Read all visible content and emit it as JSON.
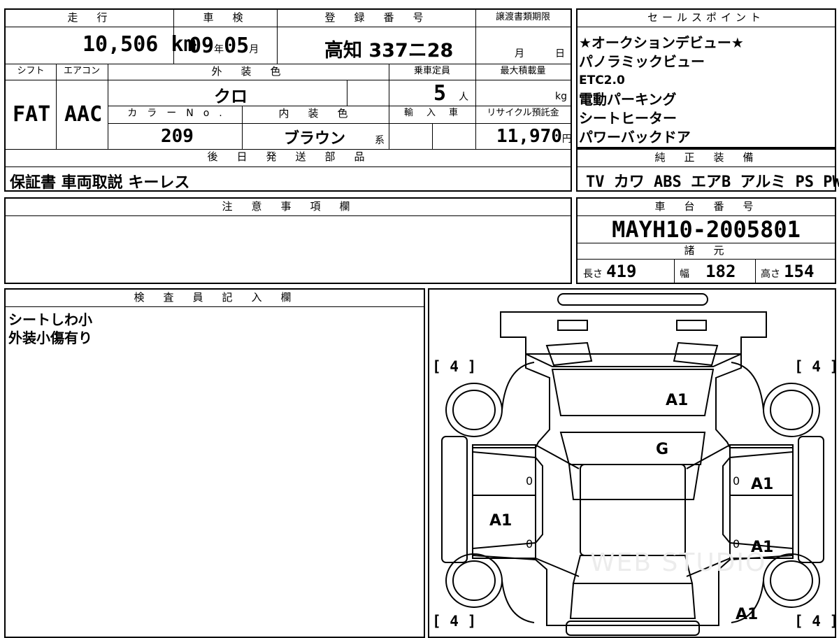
{
  "top_table": {
    "headers": {
      "mileage": "走　行",
      "inspection": "車　検",
      "registration": "登　録　番　号",
      "transfer_deadline": "譲渡書類期限",
      "shift": "シフト",
      "aircon": "エアコン",
      "exterior_color": "外　装　色",
      "capacity": "乗車定員",
      "max_load": "最大積載量",
      "color_no": "カ　ラ　ー　N　o　.",
      "interior_color": "内　装　色",
      "import": "輸　入　車",
      "recycle": "リサイクル預託金",
      "later_parts": "後　日　発　送　部　品"
    },
    "mileage_value": "10,506",
    "mileage_unit": "km",
    "inspection_year": "09",
    "inspection_year_unit": "年",
    "inspection_month": "05",
    "inspection_month_unit": "月",
    "registration_number": "高知 337ニ28",
    "deadline_month": "月",
    "deadline_day": "日",
    "shift_value": "FAT",
    "aircon_value": "AAC",
    "exterior_color_value": "クロ",
    "capacity_value": "5",
    "capacity_unit": "人",
    "max_load_unit": "kg",
    "color_no_value": "209",
    "interior_color_value": "ブラウン",
    "interior_color_suffix": "系",
    "recycle_value": "11,970",
    "recycle_unit": "円",
    "later_parts_value": "保証書 車両取説 キーレス"
  },
  "sales_points": {
    "header": "セールスポイント",
    "items": [
      "★オークションデビュー★",
      "パノラミックビュー",
      "ETC2.0",
      "電動パーキング",
      "シートヒーター",
      "パワーバックドア"
    ]
  },
  "equipment": {
    "header": "純　正　装　備",
    "value": "TV カワ ABS エアB アルミ PS PW"
  },
  "notes": {
    "header": "注　意　事　項　欄"
  },
  "chassis": {
    "header": "車　台　番　号",
    "value": "MAYH10-2005801",
    "spec_header": "諸　元",
    "length_label": "長さ",
    "length_value": "419",
    "width_label": "幅",
    "width_value": "182",
    "height_label": "高さ",
    "height_value": "154"
  },
  "inspector": {
    "header": "検　査　員　記　入　欄",
    "lines": [
      "シートしわ小",
      "外装小傷有り"
    ]
  },
  "diagram": {
    "tire_marks": [
      "[ 4 ]",
      "[ 4 ]",
      "[ 4 ]",
      "[ 4 ]"
    ],
    "damage_marks": [
      "A1",
      "G",
      "A1",
      "A1",
      "A1",
      "A1"
    ],
    "zero_marks": [
      "0",
      "0",
      "0",
      "0"
    ],
    "watermark": "WEB STUDIO"
  }
}
